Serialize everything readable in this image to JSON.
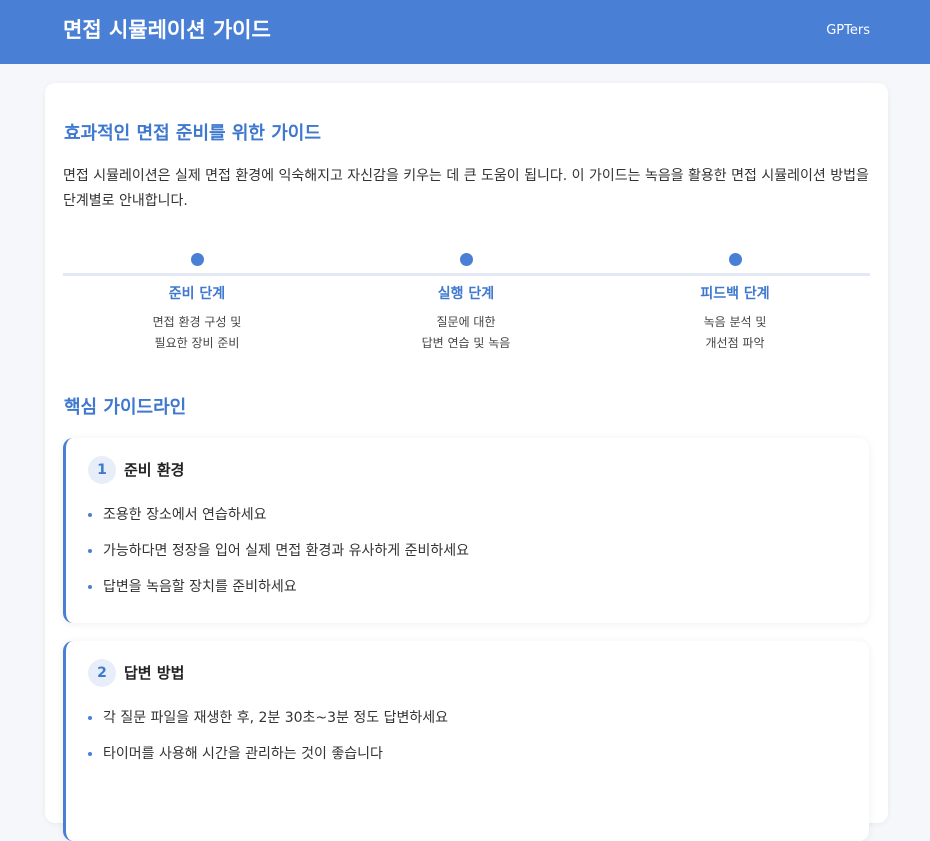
{
  "header": {
    "title": "면접 시뮬레이션 가이드",
    "brand": "GPTers"
  },
  "intro": {
    "heading": "효과적인 면접 준비를 위한 가이드",
    "text": "면접 시뮬레이션은 실제 면접 환경에 익숙해지고 자신감을 키우는 데 큰 도움이 됩니다. 이 가이드는 녹음을 활용한 면접 시뮬레이션 방법을 단계별로 안내합니다."
  },
  "timeline": [
    {
      "label": "준비 단계",
      "desc1": "면접 환경 구성 및",
      "desc2": "필요한 장비 준비"
    },
    {
      "label": "실행 단계",
      "desc1": "질문에 대한",
      "desc2": "답변 연습 및 녹음"
    },
    {
      "label": "피드백 단계",
      "desc1": "녹음 분석 및",
      "desc2": "개선점 파악"
    }
  ],
  "core": {
    "heading": "핵심 가이드라인",
    "guides": [
      {
        "number": "1",
        "title": "준비 환경",
        "items": [
          "조용한 장소에서 연습하세요",
          "가능하다면 정장을 입어 실제 면접 환경과 유사하게 준비하세요",
          "답변을 녹음할 장치를 준비하세요"
        ]
      },
      {
        "number": "2",
        "title": "답변 방법",
        "items": [
          "각 질문 파일을 재생한 후, 2분 30초~3분 정도 답변하세요",
          "타이머를 사용해 시간을 관리하는 것이 좋습니다"
        ]
      }
    ]
  },
  "colors": {
    "accent": "#4a7fd6",
    "accent_text": "#3f78cf",
    "background": "#f5f7fa"
  }
}
